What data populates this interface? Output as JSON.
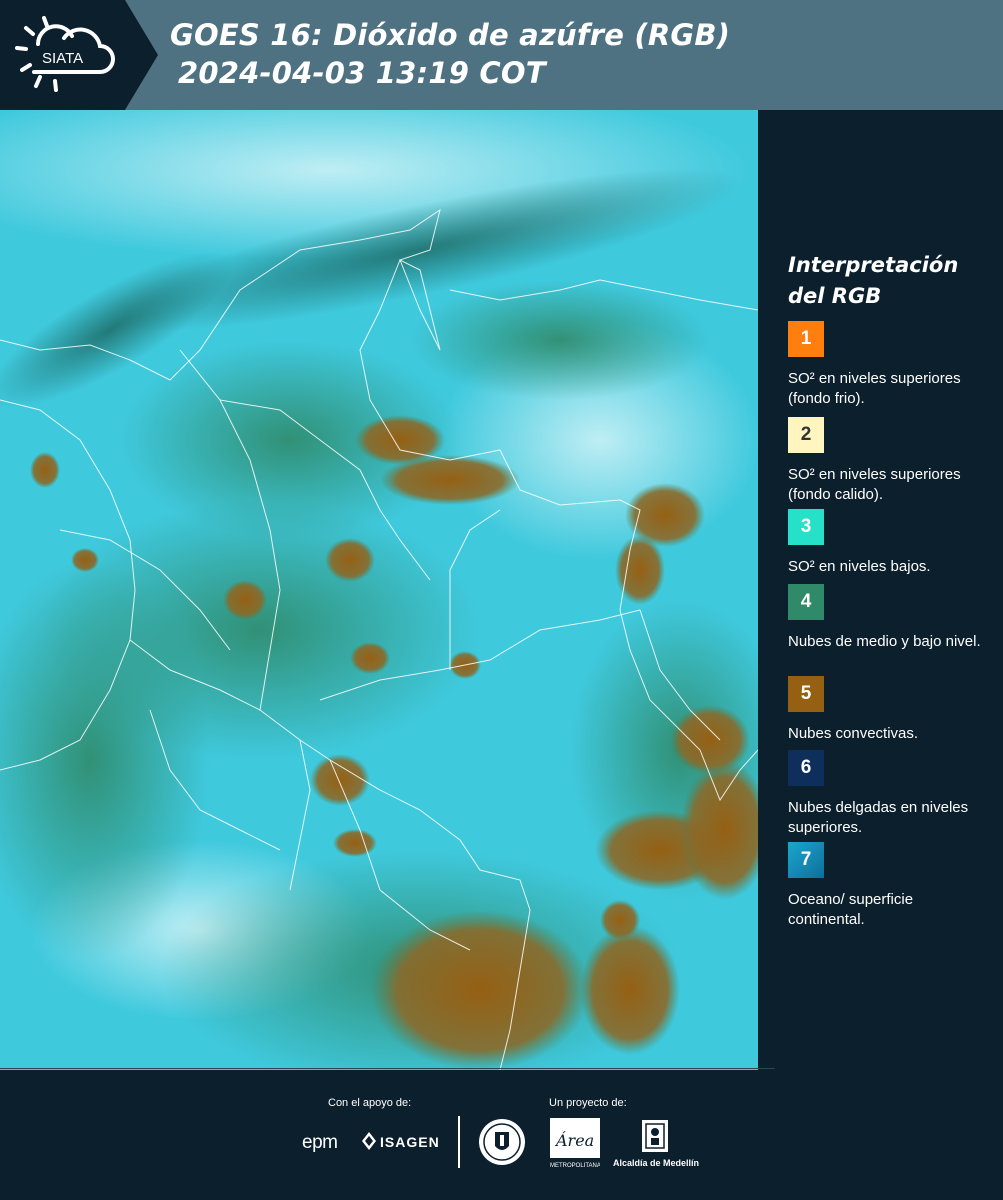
{
  "header": {
    "logo_text": "SIATA",
    "title_line1": "GOES 16: Dióxido de azúfre (RGB)",
    "title_line2": "2024-04-03 13:19 COT"
  },
  "legend": {
    "title": "Interpretación del RGB",
    "items": [
      {
        "number": "1",
        "label": "SO² en niveles superiores (fondo frio).",
        "color": "#ff7f0e"
      },
      {
        "number": "2",
        "label": "SO² en niveles superiores (fondo calido).",
        "color": "#fff5c0"
      },
      {
        "number": "3",
        "label": "SO² en niveles bajos.",
        "color": "#27e0c8"
      },
      {
        "number": "4",
        "label": "Nubes de medio y bajo nivel.",
        "color": "#2f8a6a"
      },
      {
        "number": "5",
        "label": "Nubes convectivas.",
        "color": "#966013"
      },
      {
        "number": "6",
        "label": "Nubes delgadas en niveles superiores.",
        "color": "#0e2f5c"
      },
      {
        "number": "7",
        "label": "Oceano/ superficie continental.",
        "color": "#1a8fc0"
      }
    ]
  },
  "footer": {
    "support_label": "Con el apoyo de:",
    "project_label": "Un proyecto de:",
    "sponsor_epm": "epm",
    "sponsor_isagen": "ISAGEN",
    "partner_metro": "Área Metropolitana Valle de Aburrá",
    "partner_medellin": "Alcaldía de Medellín"
  },
  "colors": {
    "background": "#0c1f2c",
    "header_band": "#4f7282",
    "map_cyan": "#3fc9dd",
    "cloud_green": "#2f8a6a",
    "convective_brown": "#966013"
  }
}
